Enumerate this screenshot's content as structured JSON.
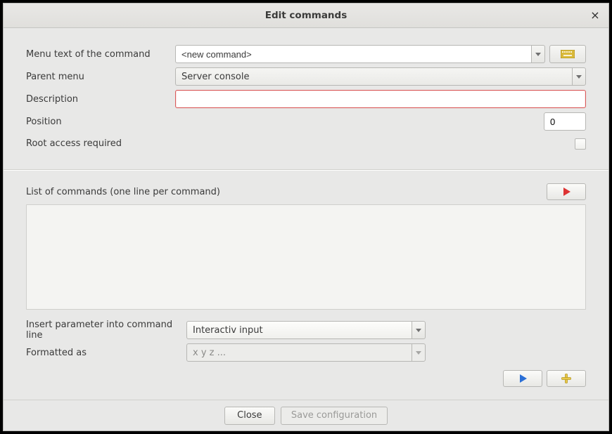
{
  "title": "Edit commands",
  "labels": {
    "menu_text": "Menu text of the command",
    "parent_menu": "Parent menu",
    "description": "Description",
    "position": "Position",
    "root_access": "Root access required",
    "list_commands": "List of commands (one line per command)",
    "insert_param": "Insert parameter into command line",
    "formatted_as": "Formatted as"
  },
  "fields": {
    "menu_text_value": "<new command>",
    "parent_menu_value": "Server console",
    "description_value": "",
    "position_value": "0",
    "root_access_checked": false,
    "commands_value": "",
    "insert_param_value": "Interactiv input",
    "formatted_as_value": "x y z ..."
  },
  "buttons": {
    "close": "Close",
    "save": "Save configuration"
  }
}
